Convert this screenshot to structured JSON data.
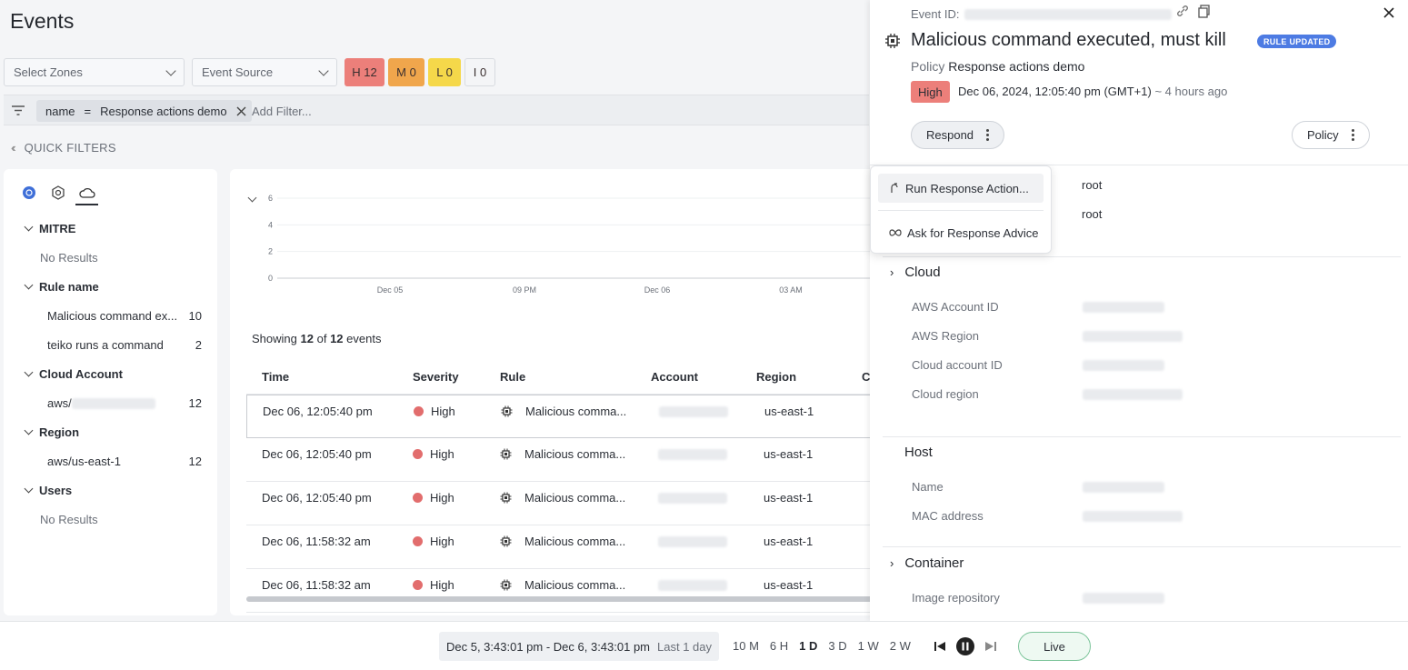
{
  "page": {
    "title": "Events"
  },
  "filters": {
    "zones_placeholder": "Select Zones",
    "source_placeholder": "Event Source",
    "severity": [
      {
        "label": "H 12",
        "color": "#ec7f7a"
      },
      {
        "label": "M 0",
        "color": "#f0a64c"
      },
      {
        "label": "L 0",
        "color": "#f5d84a"
      },
      {
        "label": "I 0",
        "color": "#f4f5f7"
      }
    ],
    "chip": {
      "key": "name",
      "op": "=",
      "value": "Response actions demo"
    },
    "add_filter_placeholder": "Add Filter..."
  },
  "quick_filters": {
    "label": "QUICK FILTERS",
    "sections": {
      "mitre": {
        "title": "MITRE",
        "empty": "No Results"
      },
      "rule_name": {
        "title": "Rule name",
        "items": [
          {
            "label": "Malicious command ex...",
            "count": "10"
          },
          {
            "label": "teiko runs a command",
            "count": "2"
          }
        ]
      },
      "cloud_account": {
        "title": "Cloud Account",
        "items": [
          {
            "label": "aws/",
            "count": "12"
          }
        ]
      },
      "region": {
        "title": "Region",
        "items": [
          {
            "label": "aws/us-east-1",
            "count": "12"
          }
        ]
      },
      "users": {
        "title": "Users",
        "empty": "No Results"
      }
    }
  },
  "chart_data": {
    "type": "bar",
    "y_ticks": [
      "0",
      "2",
      "4",
      "6"
    ],
    "x_ticks": [
      "Dec 05",
      "09 PM",
      "Dec 06",
      "03 AM"
    ],
    "ylim": [
      0,
      6
    ]
  },
  "events": {
    "showing_prefix": "Showing",
    "shown": "12",
    "of_text": "of",
    "total": "12",
    "suffix": "events",
    "columns": [
      "Time",
      "Severity",
      "Rule",
      "Account",
      "Region",
      "C"
    ],
    "rows": [
      {
        "time": "Dec 06, 12:05:40 pm",
        "severity": "High",
        "rule": "Malicious comma...",
        "region": "us-east-1"
      },
      {
        "time": "Dec 06, 12:05:40 pm",
        "severity": "High",
        "rule": "Malicious comma...",
        "region": "us-east-1"
      },
      {
        "time": "Dec 06, 12:05:40 pm",
        "severity": "High",
        "rule": "Malicious comma...",
        "region": "us-east-1"
      },
      {
        "time": "Dec 06, 11:58:32 am",
        "severity": "High",
        "rule": "Malicious comma...",
        "region": "us-east-1"
      },
      {
        "time": "Dec 06, 11:58:32 am",
        "severity": "High",
        "rule": "Malicious comma...",
        "region": "us-east-1"
      }
    ]
  },
  "detail": {
    "event_id_label": "Event ID:",
    "title": "Malicious command executed, must kill",
    "badge": "RULE UPDATED",
    "policy_label": "Policy",
    "policy_value": "Response actions demo",
    "severity": "High",
    "timestamp": "Dec 06, 2024, 12:05:40 pm (GMT+1)",
    "relative": "~ 4 hours ago",
    "respond_label": "Respond",
    "policy_button": "Policy",
    "menu": {
      "run": "Run Response Action...",
      "advice": "Ask for Response Advice"
    },
    "user_values": [
      "root",
      "root"
    ],
    "cloud": {
      "title": "Cloud",
      "keys": [
        "AWS Account ID",
        "AWS Region",
        "Cloud account ID",
        "Cloud region"
      ]
    },
    "host": {
      "title": "Host",
      "keys": [
        "Name",
        "MAC address"
      ]
    },
    "container": {
      "title": "Container",
      "keys": [
        "Image repository"
      ]
    }
  },
  "timebar": {
    "range": "Dec 5, 3:43:01 pm - Dec 6, 3:43:01 pm",
    "range_label": "Last 1 day",
    "quick": [
      "10 M",
      "6 H",
      "1 D",
      "3 D",
      "1 W",
      "2 W"
    ],
    "active": "1 D",
    "live": "Live"
  }
}
